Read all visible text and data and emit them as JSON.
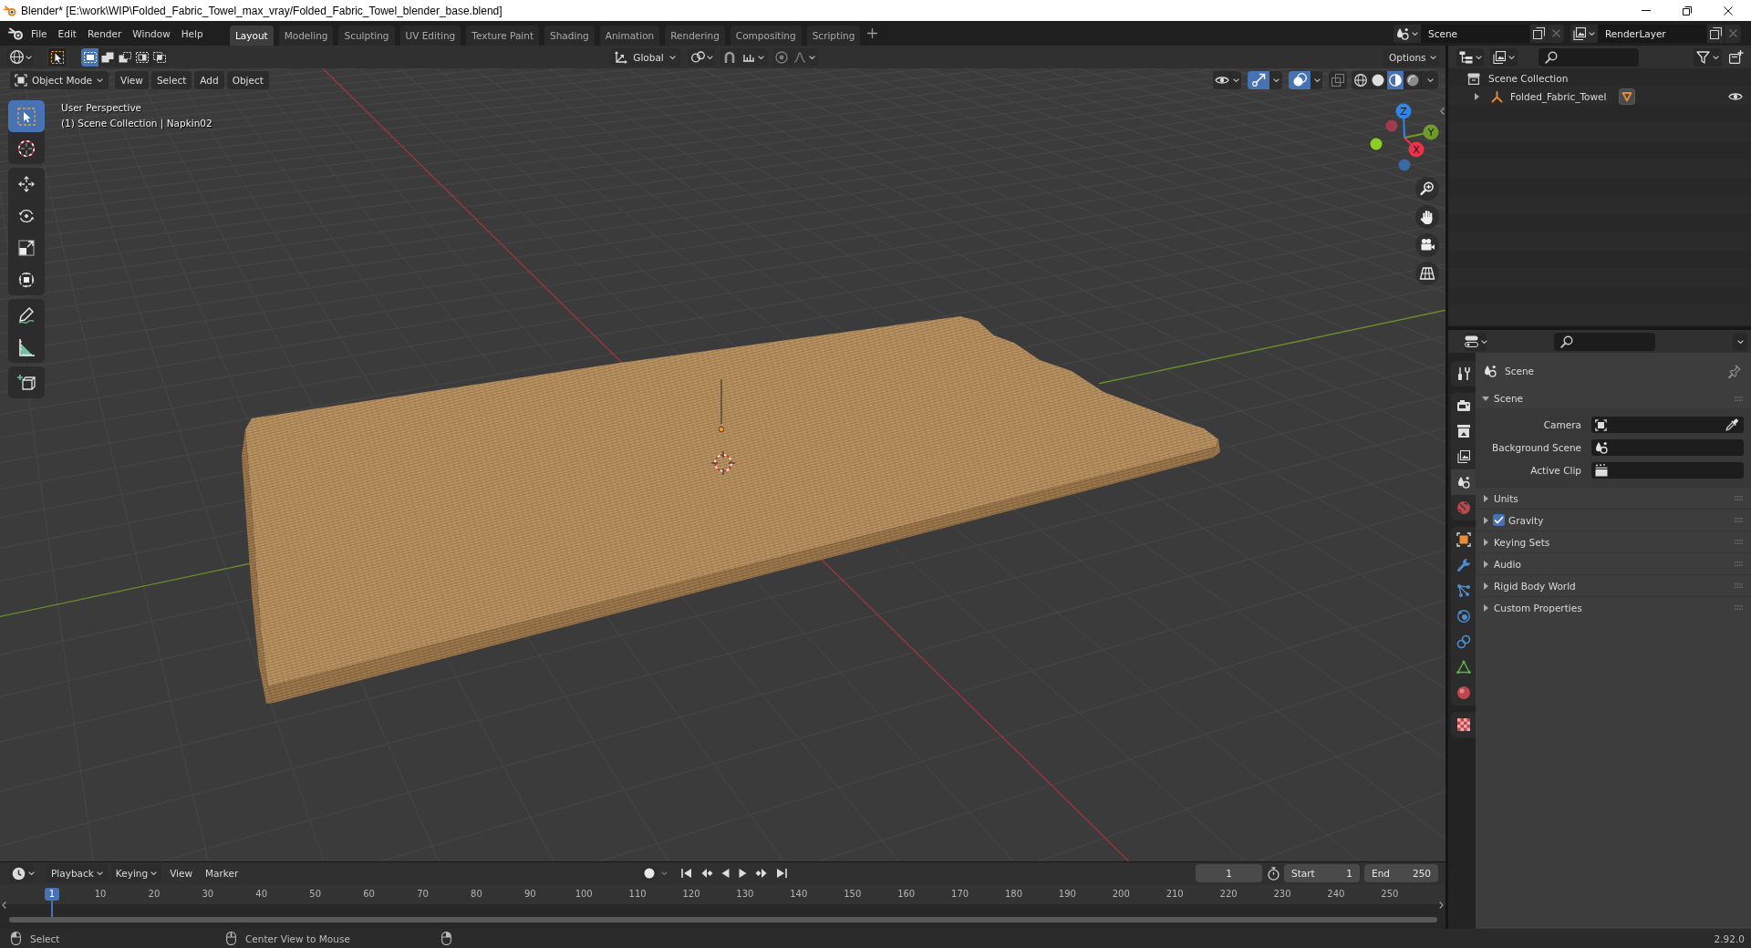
{
  "window": {
    "title": "Blender* [E:\\work\\WIP\\Folded_Fabric_Towel_max_vray/Folded_Fabric_Towel_blender_base.blend]"
  },
  "top_bar": {
    "menus": [
      "File",
      "Edit",
      "Render",
      "Window",
      "Help"
    ],
    "workspaces": [
      {
        "label": "Layout",
        "selected": true
      },
      {
        "label": "Modeling",
        "selected": false
      },
      {
        "label": "Sculpting",
        "selected": false
      },
      {
        "label": "UV Editing",
        "selected": false
      },
      {
        "label": "Texture Paint",
        "selected": false
      },
      {
        "label": "Shading",
        "selected": false
      },
      {
        "label": "Animation",
        "selected": false
      },
      {
        "label": "Rendering",
        "selected": false
      },
      {
        "label": "Compositing",
        "selected": false
      },
      {
        "label": "Scripting",
        "selected": false
      }
    ],
    "scene": "Scene",
    "view_layer": "RenderLayer"
  },
  "viewport": {
    "select_modes": [
      {
        "kind": "set",
        "selected": true
      },
      {
        "kind": "extend",
        "selected": false
      },
      {
        "kind": "subtract",
        "selected": false
      },
      {
        "kind": "invert",
        "selected": false
      },
      {
        "kind": "intersect",
        "selected": false
      }
    ],
    "orientation": "Global",
    "options": "Options",
    "mode": "Object Mode",
    "menus": [
      "View",
      "Select",
      "Add",
      "Object"
    ],
    "toggles": [
      {
        "kind": "gizmos",
        "on": true
      },
      {
        "kind": "overlays",
        "on": true
      },
      {
        "kind": "xray",
        "on": false
      }
    ],
    "shading": [
      {
        "kind": "wireframe",
        "selected": false
      },
      {
        "kind": "solid",
        "selected": false
      },
      {
        "kind": "material",
        "selected": true
      },
      {
        "kind": "rendered",
        "selected": false
      }
    ],
    "tool_groups": [
      [
        {
          "kind": "select",
          "selected": true
        },
        {
          "kind": "cursor",
          "selected": false
        }
      ],
      [
        {
          "kind": "move",
          "selected": false
        },
        {
          "kind": "rotate",
          "selected": false
        },
        {
          "kind": "scale",
          "selected": false
        },
        {
          "kind": "transform",
          "selected": false
        }
      ],
      [
        {
          "kind": "annotate",
          "selected": false
        },
        {
          "kind": "measure",
          "selected": false
        }
      ],
      [
        {
          "kind": "add_cube",
          "selected": false
        }
      ]
    ],
    "view_name": "User Perspective",
    "collection_info": "(1) Scene Collection | Napkin02",
    "gizmo_axes": [
      "X",
      "Y",
      "Z"
    ]
  },
  "outliner": {
    "root": "Scene Collection",
    "objects": [
      {
        "label": "Folded_Fabric_Towel",
        "expanded": false
      }
    ]
  },
  "properties": {
    "tab_groups": [
      [
        {
          "kind": "tool",
          "selected": false
        }
      ],
      [
        {
          "kind": "render",
          "selected": false
        },
        {
          "kind": "output",
          "selected": false
        },
        {
          "kind": "view_layer",
          "selected": false
        },
        {
          "kind": "scene",
          "selected": true
        },
        {
          "kind": "world",
          "selected": false
        }
      ],
      [
        {
          "kind": "object",
          "selected": false
        },
        {
          "kind": "modifiers",
          "selected": false
        },
        {
          "kind": "particles",
          "selected": false
        },
        {
          "kind": "physics",
          "selected": false
        },
        {
          "kind": "constraints",
          "selected": false
        },
        {
          "kind": "data",
          "selected": false
        },
        {
          "kind": "material",
          "selected": false
        }
      ],
      [
        {
          "kind": "texture",
          "selected": false
        }
      ]
    ],
    "context": "Scene",
    "panels": [
      {
        "kind": "plain",
        "label": "Scene",
        "expanded": true,
        "fields": [
          {
            "kind": "camera",
            "label": "Camera"
          },
          {
            "kind": "scene",
            "label": "Background Scene"
          },
          {
            "kind": "clip",
            "label": "Active Clip"
          }
        ]
      },
      {
        "kind": "plain",
        "label": "Units",
        "expanded": false
      },
      {
        "kind": "checkbox",
        "label": "Gravity",
        "checked": true,
        "expanded": false
      },
      {
        "kind": "plain",
        "label": "Keying Sets",
        "expanded": false
      },
      {
        "kind": "plain",
        "label": "Audio",
        "expanded": false
      },
      {
        "kind": "plain",
        "label": "Rigid Body World",
        "expanded": false
      },
      {
        "kind": "plain",
        "label": "Custom Properties",
        "expanded": false
      }
    ]
  },
  "timeline": {
    "menus": [
      {
        "kind": "popover",
        "label": "Playback"
      },
      {
        "kind": "popover",
        "label": "Keying"
      },
      {
        "kind": "menu",
        "label": "View"
      },
      {
        "kind": "menu",
        "label": "Marker"
      }
    ],
    "current_frame": "1",
    "start_label": "Start",
    "start": "1",
    "end_label": "End",
    "end": "250",
    "playhead": "1",
    "ruler": [
      "10",
      "20",
      "30",
      "40",
      "50",
      "60",
      "70",
      "80",
      "90",
      "100",
      "110",
      "120",
      "130",
      "140",
      "150",
      "160",
      "170",
      "180",
      "190",
      "200",
      "210",
      "220",
      "230",
      "240",
      "250"
    ]
  },
  "status_bar": {
    "hints": [
      "Select",
      "Center View to Mouse"
    ],
    "version": "2.92.0"
  }
}
